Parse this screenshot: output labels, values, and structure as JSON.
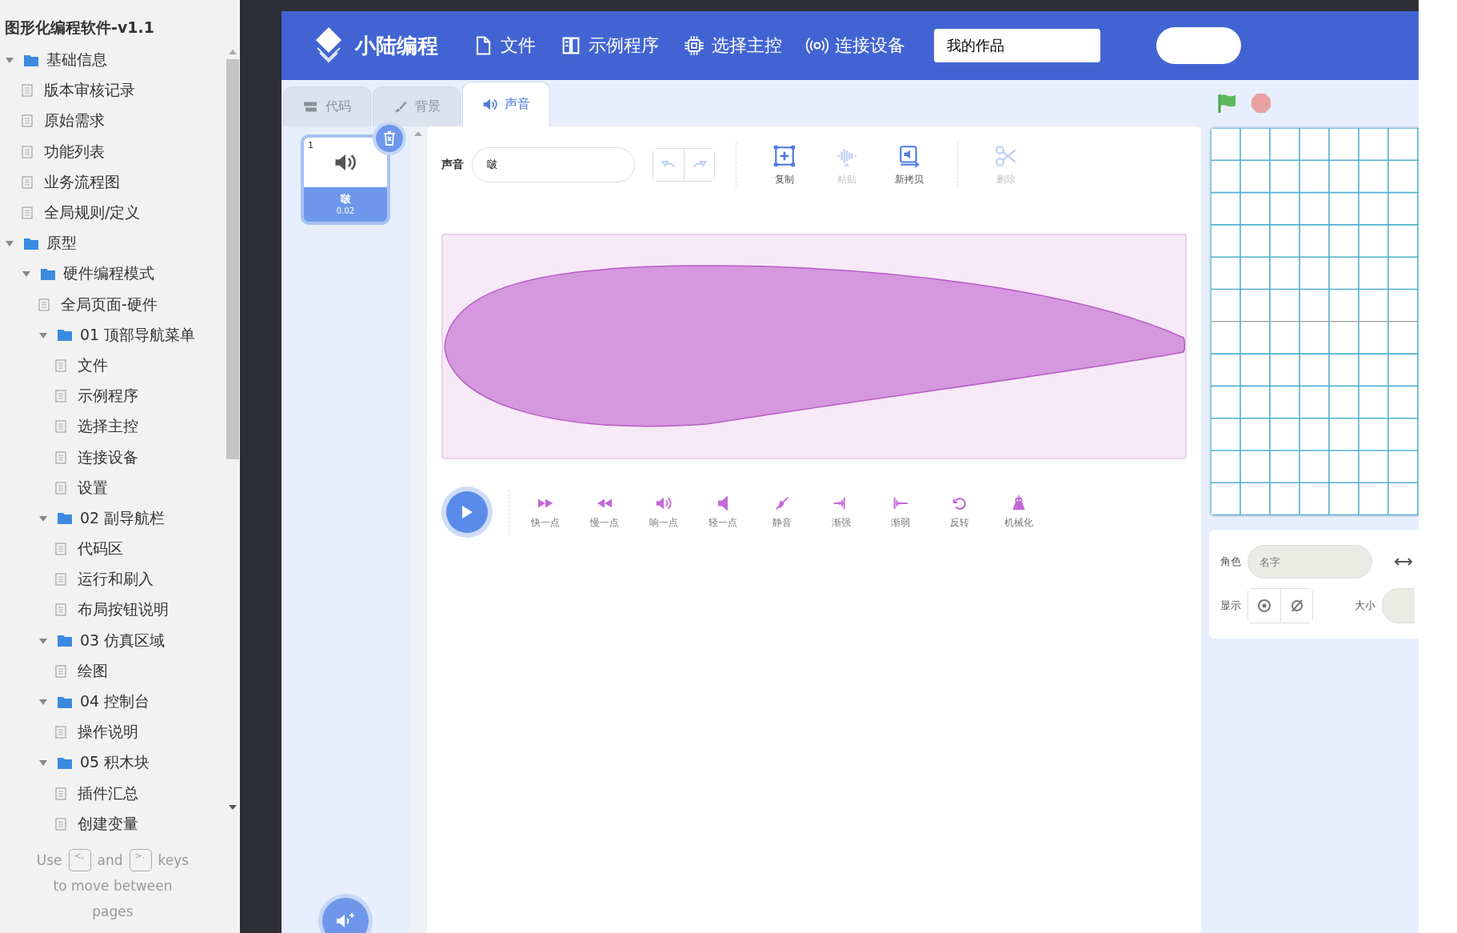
{
  "sidebar": {
    "title": "图形化编程软件-v1.1",
    "tree": [
      {
        "label": "基础信息",
        "expanded": true,
        "children": [
          {
            "label": "版本审核记录"
          },
          {
            "label": "原始需求"
          },
          {
            "label": "功能列表"
          },
          {
            "label": "业务流程图"
          },
          {
            "label": "全局规则/定义"
          }
        ]
      },
      {
        "label": "原型",
        "expanded": true,
        "children": [
          {
            "label": "硬件编程模式",
            "expanded": true,
            "children": [
              {
                "label": "全局页面-硬件"
              },
              {
                "label": "01 顶部导航菜单",
                "expanded": true,
                "children": [
                  {
                    "label": "文件"
                  },
                  {
                    "label": "示例程序"
                  },
                  {
                    "label": "选择主控"
                  },
                  {
                    "label": "连接设备"
                  },
                  {
                    "label": "设置"
                  }
                ]
              },
              {
                "label": "02 副导航栏",
                "expanded": true,
                "children": [
                  {
                    "label": "代码区"
                  },
                  {
                    "label": "运行和刷入"
                  },
                  {
                    "label": "布局按钮说明"
                  }
                ]
              },
              {
                "label": "03 仿真区域",
                "expanded": true,
                "children": [
                  {
                    "label": "绘图"
                  }
                ]
              },
              {
                "label": "04 控制台",
                "expanded": true,
                "children": [
                  {
                    "label": "操作说明"
                  }
                ]
              },
              {
                "label": "05 积木块",
                "expanded": true,
                "children": [
                  {
                    "label": "插件汇总"
                  },
                  {
                    "label": "创建变量"
                  }
                ]
              }
            ]
          }
        ]
      }
    ],
    "footer": [
      {
        "kind": "text",
        "text": "Use"
      },
      {
        "kind": "key",
        "text": "<,"
      },
      {
        "kind": "text",
        "text": "and"
      },
      {
        "kind": "key",
        "text": ">."
      },
      {
        "kind": "text",
        "text": "keys"
      },
      {
        "kind": "break"
      },
      {
        "kind": "text",
        "text": "to move between"
      },
      {
        "kind": "break"
      },
      {
        "kind": "text",
        "text": "pages"
      }
    ]
  },
  "navbar": {
    "brand": "小陆编程",
    "menu": [
      {
        "label": "文件"
      },
      {
        "label": "示例程序"
      },
      {
        "label": "选择主控"
      },
      {
        "label": "连接设备"
      }
    ],
    "project_field": {
      "value": "我的作品"
    }
  },
  "tabs": [
    {
      "label": "代码",
      "selected": false
    },
    {
      "label": "背景",
      "selected": false
    },
    {
      "label": "声音",
      "selected": true
    }
  ],
  "sound_list": [
    {
      "number": "1",
      "name": "啵",
      "duration": "0.02",
      "selected": true
    }
  ],
  "editor": {
    "name_label": "声音",
    "name_value": "啵",
    "history": [
      {
        "kind": "undo",
        "disabled": true
      },
      {
        "kind": "redo",
        "disabled": true
      }
    ],
    "tools": [
      {
        "label": "复制",
        "disabled": false
      },
      {
        "label": "粘贴",
        "disabled": true
      },
      {
        "label": "新拷贝",
        "disabled": false
      },
      {
        "label": "删除",
        "disabled": true
      }
    ],
    "effects": [
      {
        "label": "快一点"
      },
      {
        "label": "慢一点"
      },
      {
        "label": "响一点"
      },
      {
        "label": "轻一点"
      },
      {
        "label": "静音"
      },
      {
        "label": "渐强"
      },
      {
        "label": "渐弱"
      },
      {
        "label": "反转"
      },
      {
        "label": "机械化"
      }
    ]
  },
  "sprite_panel": {
    "sprite_label": "角色",
    "name_placeholder": "名字",
    "show_label": "显示",
    "visibility": [
      {
        "kind": "show",
        "selected": false
      },
      {
        "kind": "hide",
        "selected": false
      }
    ],
    "size_label": "大小"
  }
}
